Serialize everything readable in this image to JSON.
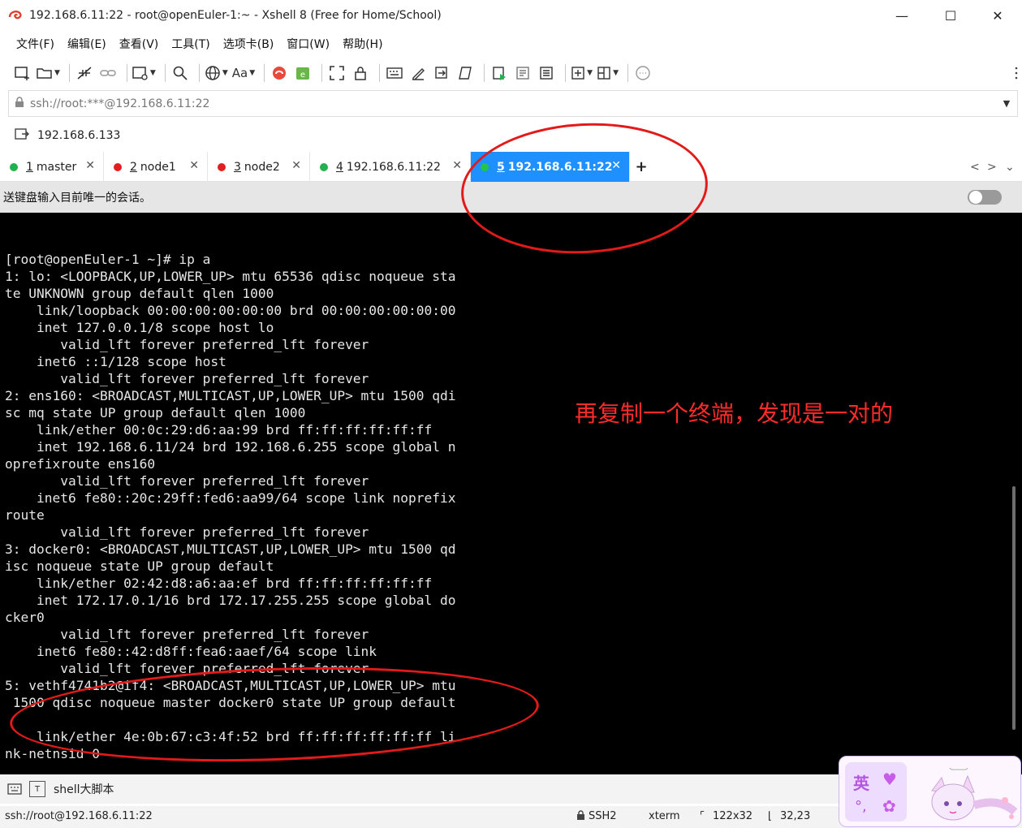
{
  "window": {
    "title": "192.168.6.11:22 - root@openEuler-1:~ - Xshell 8 (Free for Home/School)",
    "minimize": "—",
    "maximize": "☐",
    "close": "✕"
  },
  "menu": [
    "文件(F)",
    "编辑(E)",
    "查看(V)",
    "工具(T)",
    "选项卡(B)",
    "窗口(W)",
    "帮助(H)"
  ],
  "address": {
    "value": "ssh://root:***@192.168.6.11:22"
  },
  "session": {
    "host": "192.168.6.133"
  },
  "tabs": [
    {
      "num": "1",
      "label": "master",
      "dot": "#22b14c",
      "active": false
    },
    {
      "num": "2",
      "label": "node1",
      "dot": "#e02020",
      "active": false
    },
    {
      "num": "3",
      "label": "node2",
      "dot": "#e02020",
      "active": false
    },
    {
      "num": "4",
      "label": "192.168.6.11:22",
      "dot": "#22b14c",
      "active": false
    },
    {
      "num": "5",
      "label": "192.168.6.11:22",
      "dot": "#22c44c",
      "active": true
    }
  ],
  "tab_add": "+",
  "broadcast": {
    "text": "送键盘输入目前唯一的会话。"
  },
  "terminal": {
    "lines": [
      "[root@openEuler-1 ~]# ip a",
      "1: lo: <LOOPBACK,UP,LOWER_UP> mtu 65536 qdisc noqueue sta",
      "te UNKNOWN group default qlen 1000",
      "    link/loopback 00:00:00:00:00:00 brd 00:00:00:00:00:00",
      "    inet 127.0.0.1/8 scope host lo",
      "       valid_lft forever preferred_lft forever",
      "    inet6 ::1/128 scope host",
      "       valid_lft forever preferred_lft forever",
      "2: ens160: <BROADCAST,MULTICAST,UP,LOWER_UP> mtu 1500 qdi",
      "sc mq state UP group default qlen 1000",
      "    link/ether 00:0c:29:d6:aa:99 brd ff:ff:ff:ff:ff:ff",
      "    inet 192.168.6.11/24 brd 192.168.6.255 scope global n",
      "oprefixroute ens160",
      "       valid_lft forever preferred_lft forever",
      "    inet6 fe80::20c:29ff:fed6:aa99/64 scope link noprefix",
      "route",
      "       valid_lft forever preferred_lft forever",
      "3: docker0: <BROADCAST,MULTICAST,UP,LOWER_UP> mtu 1500 qd",
      "isc noqueue state UP group default",
      "    link/ether 02:42:d8:a6:aa:ef brd ff:ff:ff:ff:ff:ff",
      "    inet 172.17.0.1/16 brd 172.17.255.255 scope global do",
      "cker0",
      "       valid_lft forever preferred_lft forever",
      "    inet6 fe80::42:d8ff:fea6:aaef/64 scope link",
      "       valid_lft forever preferred_lft forever",
      "5: vethf4741b2@if4: <BROADCAST,MULTICAST,UP,LOWER_UP> mtu",
      " 1500 qdisc noqueue master docker0 state UP group default",
      "",
      "    link/ether 4e:0b:67:c3:4f:52 brd ff:ff:ff:ff:ff:ff li",
      "nk-netnsid 0"
    ],
    "annotation": "再复制一个终端，发现是一对的"
  },
  "bottombar": {
    "label": "shell大脚本"
  },
  "status": {
    "connection": "ssh://root@192.168.6.11:22",
    "protocol": "SSH2",
    "term": "xterm",
    "size": "122x32",
    "cursor": "32,23"
  },
  "ime": {
    "mode": "英",
    "punct": "°,"
  },
  "colors": {
    "accent": "#1e90ff",
    "annotation": "#ff2a2a",
    "terminal_bg": "#000000",
    "terminal_fg": "#e6e6e6"
  }
}
